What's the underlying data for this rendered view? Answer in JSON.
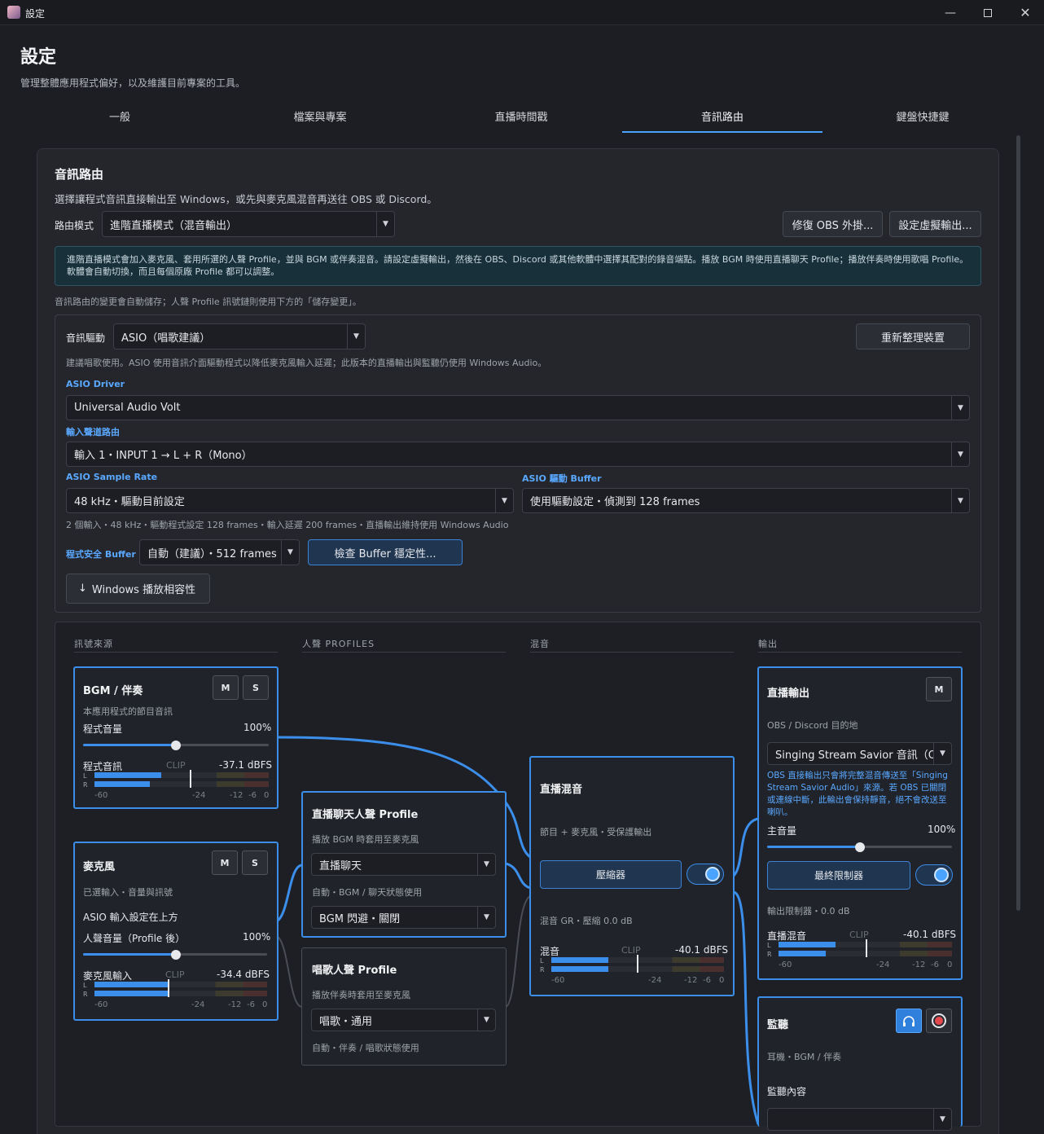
{
  "window": {
    "title": "設定"
  },
  "header": {
    "title": "設定",
    "subtitle": "管理整體應用程式偏好，以及維護目前專案的工具。"
  },
  "tabs": [
    {
      "label": "一般"
    },
    {
      "label": "檔案與專案"
    },
    {
      "label": "直播時間戳"
    },
    {
      "label": "音訊路由",
      "active": true
    },
    {
      "label": "鍵盤快捷鍵"
    }
  ],
  "routing": {
    "title": "音訊路由",
    "description": "選擇讓程式音訊直接輸出至 Windows，或先與麥克風混音再送往 OBS 或 Discord。",
    "mode_label": "路由模式",
    "mode_value": "進階直播模式（混音輸出）",
    "fix_obs_button": "修復 OBS 外掛...",
    "virtual_out_button": "設定虛擬輸出...",
    "info": "進階直播模式會加入麥克風、套用所選的人聲 Profile，並與 BGM 或伴奏混音。請設定虛擬輸出，然後在 OBS、Discord 或其他軟體中選擇其配對的錄音端點。播放 BGM 時使用直播聊天 Profile；播放伴奏時使用歌唱 Profile。軟體會自動切換，而且每個原廠 Profile 都可以調整。",
    "autosave_note": "音訊路由的變更會自動儲存；人聲 Profile 訊號鏈則使用下方的「儲存變更」。"
  },
  "driver": {
    "label": "音訊驅動",
    "value": "ASIO（唱歌建議）",
    "refresh_button": "重新整理裝置",
    "hint": "建議唱歌使用。ASIO 使用音訊介面驅動程式以降低麥克風輸入延遲；此版本的直播輸出與監聽仍使用 Windows Audio。",
    "asio_driver_label": "ASIO Driver",
    "asio_driver_value": "Universal Audio Volt",
    "input_route_label": "輸入聲道路由",
    "input_route_value": "輸入 1・INPUT 1 → L + R（Mono）",
    "sample_rate_label": "ASIO Sample Rate",
    "sample_rate_value": "48 kHz・驅動目前設定",
    "buffer_label": "ASIO 驅動 Buffer",
    "buffer_value": "使用驅動設定・偵測到 128 frames",
    "status_line": "2 個輸入・48 kHz・驅動程式設定 128 frames・輸入延遲 200 frames・直播輸出維持使用 Windows Audio",
    "safe_buffer_label": "程式安全 Buffer",
    "safe_buffer_value": "自動（建議）・512 frames",
    "check_buffer_button": "檢查 Buffer 穩定性...",
    "compat_button": "Windows 播放相容性"
  },
  "graph": {
    "col_sources": "訊號來源",
    "col_profiles": "人聲 PROFILES",
    "col_mix": "混音",
    "col_output": "輸出",
    "bgm": {
      "title": "BGM / 伴奏",
      "m": "M",
      "s": "S",
      "sub": "本應用程式的節目音訊",
      "vol_label": "程式音量",
      "vol_value": "100%",
      "vol_level": 1.0,
      "meter_label": "程式音訊",
      "clip": "CLIP",
      "db": "-37.1 dBFS",
      "meter_l": 0.45,
      "meter_r": 0.38
    },
    "mic": {
      "title": "麥克風",
      "m": "M",
      "s": "S",
      "sub": "已選輸入・音量與訊號",
      "asio_note": "ASIO 輸入設定在上方",
      "vol_label": "人聲音量（Profile 後）",
      "vol_value": "100%",
      "vol_level": 1.0,
      "meter_label": "麥克風輸入",
      "clip": "CLIP",
      "db": "-34.4 dBFS",
      "meter_l": 0.43,
      "meter_r": 0.43
    },
    "chat_profile": {
      "title": "直播聊天人聲 Profile",
      "sub": "播放 BGM 時套用至麥克風",
      "select": "直播聊天",
      "auto_label": "自動・BGM / 聊天狀態使用",
      "ducking": "BGM 閃避・關閉"
    },
    "sing_profile": {
      "title": "唱歌人聲 Profile",
      "sub": "播放伴奏時套用至麥克風",
      "select": "唱歌・通用",
      "auto_label": "自動・伴奏 / 唱歌狀態使用"
    },
    "mix": {
      "title": "直播混音",
      "sub": "節目 + 麥克風・受保護輸出",
      "compressor": "壓縮器",
      "toggle_on": true,
      "gr": "混音 GR・壓縮 0.0 dB",
      "meter_label": "混音",
      "clip": "CLIP",
      "db": "-40.1 dBFS",
      "meter_l": 0.33,
      "meter_r": 0.33
    },
    "stream_out": {
      "title": "直播輸出",
      "m": "M",
      "sub": "OBS / Discord 目的地",
      "select": "Singing Stream Savior 音訊（O",
      "note": "OBS 直接輸出只會將完整混音傳送至「Singing Stream Savior Audio」來源。若 OBS 已關閉或連線中斷，此輸出會保持靜音，絕不會改送至喇叭。",
      "vol_label": "主音量",
      "vol_value": "100%",
      "vol_level": 1.0,
      "limiter": "最終限制器",
      "toggle_on": true,
      "limiter_note": "輸出限制器・0.0 dB",
      "meter_label": "直播混音",
      "clip": "CLIP",
      "db": "-40.1 dBFS",
      "meter_l": 0.33,
      "meter_r": 0.27
    },
    "monitor": {
      "title": "監聽",
      "sub": "耳機・BGM / 伴奏",
      "content_label": "監聽內容"
    },
    "scale": [
      "-60",
      "-24",
      "-12",
      "-6",
      "0"
    ],
    "ch_l": "L",
    "ch_r": "R"
  }
}
